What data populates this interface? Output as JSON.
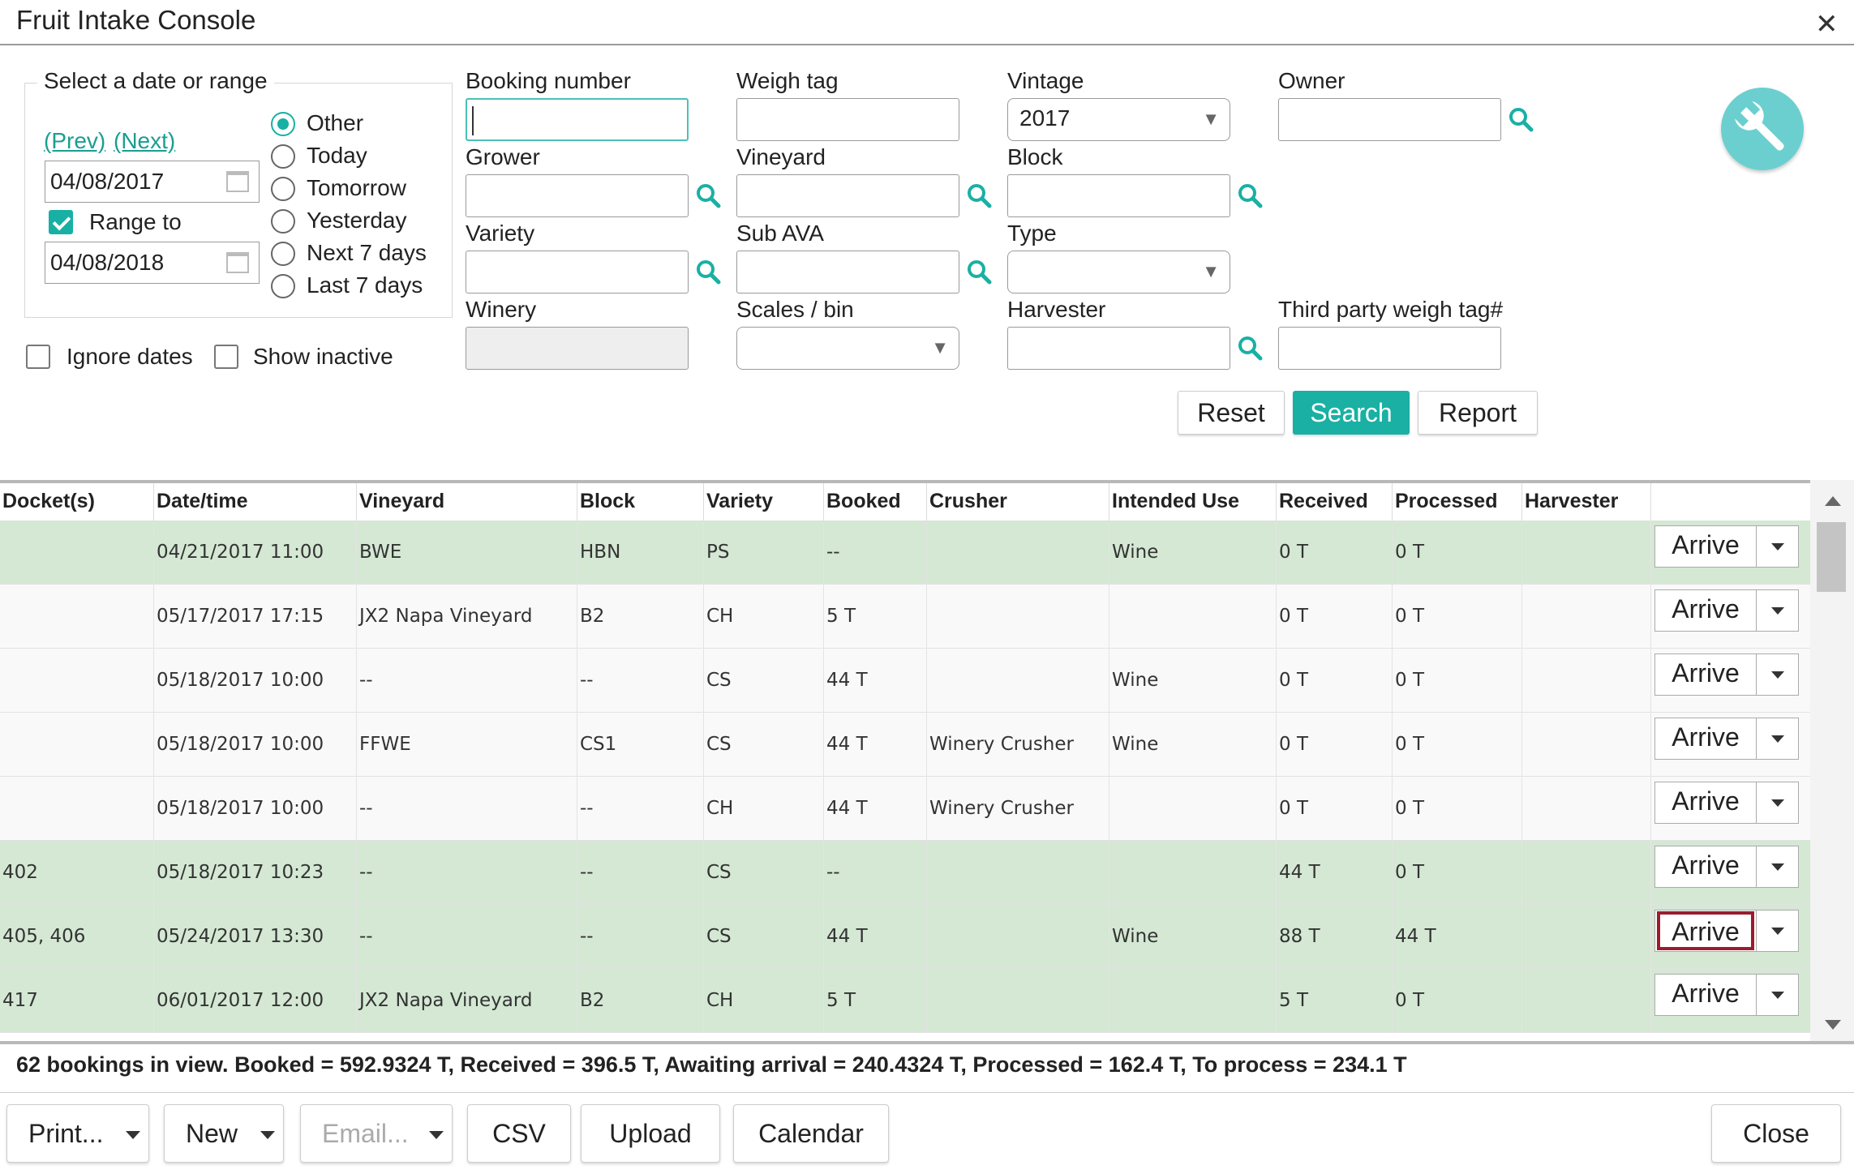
{
  "window": {
    "title": "Fruit Intake Console",
    "close_symbol": "✕"
  },
  "date_range": {
    "legend": "Select a date or range",
    "prev_label": "(Prev)",
    "next_label": "(Next)",
    "start_date": "04/08/2017",
    "range_to_label": "Range to",
    "range_to_checked": true,
    "end_date": "04/08/2018",
    "presets": [
      {
        "label": "Other",
        "selected": true
      },
      {
        "label": "Today",
        "selected": false
      },
      {
        "label": "Tomorrow",
        "selected": false
      },
      {
        "label": "Yesterday",
        "selected": false
      },
      {
        "label": "Next 7 days",
        "selected": false
      },
      {
        "label": "Last 7 days",
        "selected": false
      }
    ],
    "ignore_dates_label": "Ignore dates",
    "show_inactive_label": "Show inactive"
  },
  "filters": {
    "booking_number": {
      "label": "Booking number",
      "value": ""
    },
    "weigh_tag": {
      "label": "Weigh tag",
      "value": ""
    },
    "vintage": {
      "label": "Vintage",
      "value": "2017"
    },
    "owner": {
      "label": "Owner",
      "value": ""
    },
    "grower": {
      "label": "Grower",
      "value": ""
    },
    "vineyard": {
      "label": "Vineyard",
      "value": ""
    },
    "block": {
      "label": "Block",
      "value": ""
    },
    "variety": {
      "label": "Variety",
      "value": ""
    },
    "sub_ava": {
      "label": "Sub AVA",
      "value": ""
    },
    "type": {
      "label": "Type",
      "value": ""
    },
    "winery": {
      "label": "Winery",
      "value": ""
    },
    "scales_bin": {
      "label": "Scales / bin",
      "value": ""
    },
    "harvester": {
      "label": "Harvester",
      "value": ""
    },
    "third_party": {
      "label": "Third party weigh tag#",
      "value": ""
    }
  },
  "actions": {
    "reset": "Reset",
    "search": "Search",
    "report": "Report"
  },
  "grid": {
    "columns": [
      "Docket(s)",
      "Date/time",
      "Vineyard",
      "Block",
      "Variety",
      "Booked",
      "Crusher",
      "Intended Use",
      "Received",
      "Processed",
      "Harvester"
    ],
    "arrive_label": "Arrive",
    "rows": [
      {
        "docket": "",
        "datetime": "04/21/2017 11:00",
        "vineyard": "BWE",
        "block": "HBN",
        "variety": "PS",
        "booked": "--",
        "crusher": "",
        "use": "Wine",
        "received": "0 T",
        "processed": "0 T",
        "harvester": ""
      },
      {
        "docket": "",
        "datetime": "05/17/2017 17:15",
        "vineyard": "JX2 Napa Vineyard",
        "block": "B2",
        "variety": "CH",
        "booked": "5 T",
        "crusher": "",
        "use": "",
        "received": "0 T",
        "processed": "0 T",
        "harvester": ""
      },
      {
        "docket": "",
        "datetime": "05/18/2017 10:00",
        "vineyard": "--",
        "block": "--",
        "variety": "CS",
        "booked": "44 T",
        "crusher": "",
        "use": "Wine",
        "received": "0 T",
        "processed": "0 T",
        "harvester": ""
      },
      {
        "docket": "",
        "datetime": "05/18/2017 10:00",
        "vineyard": "FFWE",
        "block": "CS1",
        "variety": "CS",
        "booked": "44 T",
        "crusher": "Winery Crusher",
        "use": "Wine",
        "received": "0 T",
        "processed": "0 T",
        "harvester": ""
      },
      {
        "docket": "",
        "datetime": "05/18/2017 10:00",
        "vineyard": "--",
        "block": "--",
        "variety": "CH",
        "booked": "44 T",
        "crusher": "Winery Crusher",
        "use": "",
        "received": "0 T",
        "processed": "0 T",
        "harvester": ""
      },
      {
        "docket": "402",
        "datetime": "05/18/2017 10:23",
        "vineyard": "--",
        "block": "--",
        "variety": "CS",
        "booked": "--",
        "crusher": "",
        "use": "",
        "received": "44 T",
        "processed": "0 T",
        "harvester": ""
      },
      {
        "docket": "405, 406",
        "datetime": "05/24/2017 13:30",
        "vineyard": "--",
        "block": "--",
        "variety": "CS",
        "booked": "44 T",
        "crusher": "",
        "use": "Wine",
        "received": "88 T",
        "processed": "44 T",
        "harvester": ""
      },
      {
        "docket": "417",
        "datetime": "06/01/2017 12:00",
        "vineyard": "JX2 Napa Vineyard",
        "block": "B2",
        "variety": "CH",
        "booked": "5 T",
        "crusher": "",
        "use": "",
        "received": "5 T",
        "processed": "0 T",
        "harvester": ""
      }
    ]
  },
  "summary": "62 bookings in view. Booked = 592.9324 T, Received = 396.5 T, Awaiting arrival = 240.4324 T, Processed = 162.4 T, To process = 234.1 T",
  "footer": {
    "print": "Print...",
    "new": "New",
    "email": "Email...",
    "csv": "CSV",
    "upload": "Upload",
    "calendar": "Calendar",
    "close": "Close"
  },
  "colors": {
    "accent": "#1ab0a4",
    "row_green": "#d4e8d4",
    "highlight": "#9b1c2e"
  },
  "icons": [
    "search-icon",
    "calendar-icon",
    "wrench-icon",
    "close-icon",
    "chevron-down-icon"
  ]
}
